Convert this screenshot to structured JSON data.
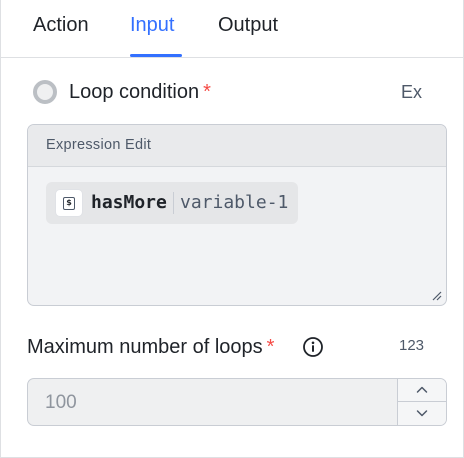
{
  "tabs": [
    {
      "label": "Action",
      "active": false
    },
    {
      "label": "Input",
      "active": true
    },
    {
      "label": "Output",
      "active": false
    }
  ],
  "accent_color": "#3370ff",
  "required_color": "#f54a45",
  "loop_condition": {
    "label": "Loop condition",
    "required_mark": "*",
    "mode_button": "Ex",
    "editor": {
      "title": "Expression Edit",
      "chip": {
        "icon": "dollar-variable-icon",
        "icon_glyph": "$",
        "name": "hasMore",
        "source": "variable-1"
      }
    }
  },
  "max_loops": {
    "label": "Maximum number of loops",
    "required_mark": "*",
    "info_icon": "info-icon",
    "type_badge": "123",
    "value": "100"
  }
}
